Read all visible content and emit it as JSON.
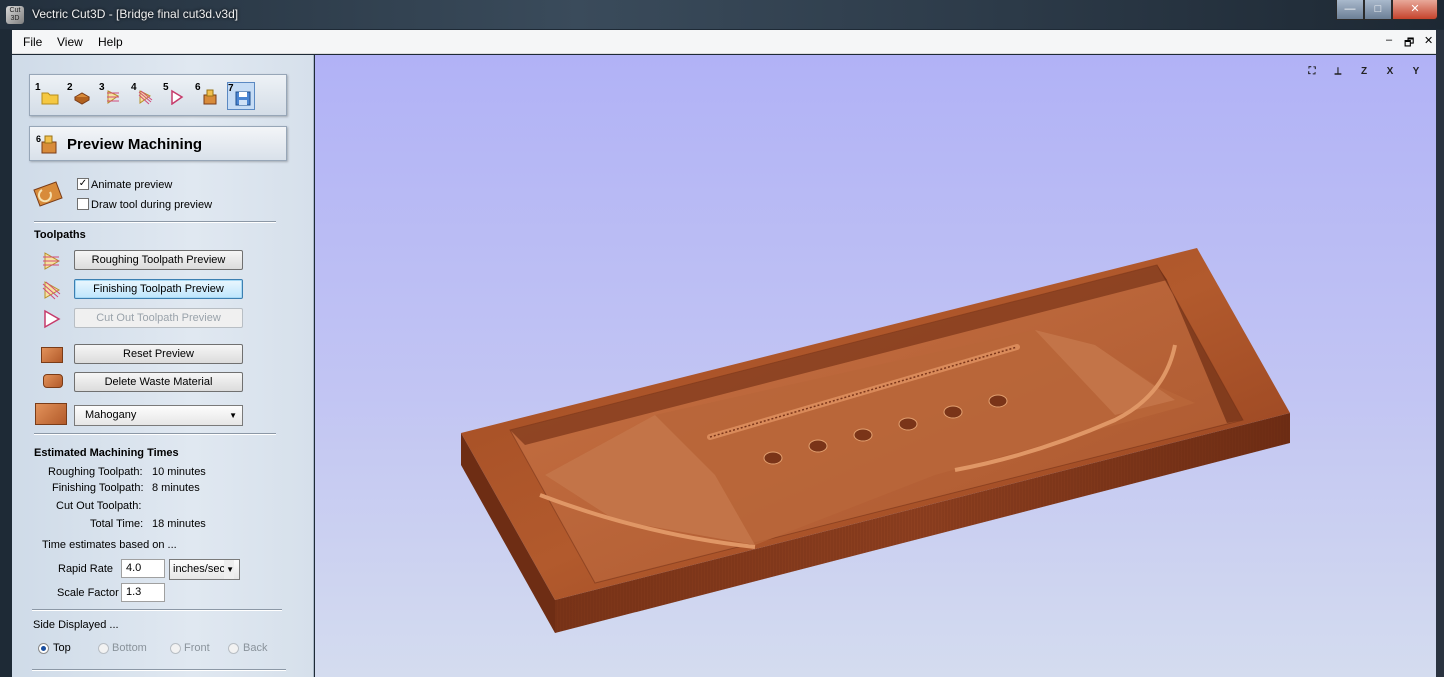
{
  "window": {
    "title": "Vectric Cut3D - [Bridge final cut3d.v3d]",
    "app_icon_text": "Cut 3D",
    "controls": {
      "minimize": "—",
      "maximize": "□",
      "close": "✕"
    }
  },
  "menu": {
    "file": "File",
    "view": "View",
    "help": "Help",
    "mdi_min": "–",
    "mdi_restore": "🗗",
    "mdi_close": "✕"
  },
  "steps": [
    "1",
    "2",
    "3",
    "4",
    "5",
    "6",
    "7"
  ],
  "heading": {
    "number": "6",
    "title": "Preview Machining"
  },
  "options": {
    "animate": "Animate preview",
    "draw_tool": "Draw tool during preview",
    "animate_checked": "✓"
  },
  "toolpaths": {
    "section": "Toolpaths",
    "roughing": "Roughing Toolpath Preview",
    "finishing": "Finishing Toolpath Preview",
    "cutout": "Cut Out Toolpath Preview",
    "reset": "Reset Preview",
    "delete_waste": "Delete Waste Material",
    "material": "Mahogany"
  },
  "times": {
    "section": "Estimated Machining Times",
    "roughing_label": "Roughing Toolpath:",
    "roughing_value": "10 minutes",
    "finishing_label": "Finishing Toolpath:",
    "finishing_value": "8 minutes",
    "cutout_label": "Cut Out Toolpath:",
    "cutout_value": "",
    "total_label": "Total Time:",
    "total_value": "18 minutes",
    "basis": "Time estimates based on ...",
    "rapid_label": "Rapid Rate",
    "rapid_value": "4.0",
    "rapid_unit": "inches/sec",
    "scale_label": "Scale Factor",
    "scale_value": "1.3"
  },
  "side": {
    "section": "Side Displayed ...",
    "top": "Top",
    "bottom": "Bottom",
    "front": "Front",
    "back": "Back",
    "selected": "Top"
  },
  "view_icons": [
    "⛶",
    "iso-icon",
    "Z",
    "X",
    "Y"
  ],
  "colors": {
    "viewport_top": "#b1b2f6",
    "wood_light": "#b9602f",
    "wood_dark": "#7a3418",
    "panel_bg": "#dbe4ee"
  }
}
